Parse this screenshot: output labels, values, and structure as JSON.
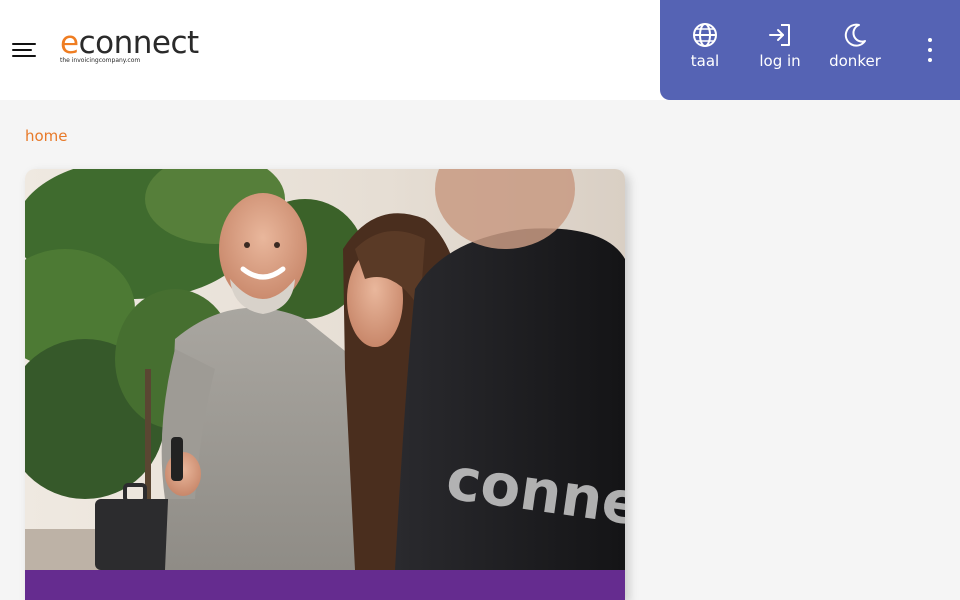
{
  "header": {
    "logo": {
      "e": "e",
      "rest": "connect",
      "tagline": "the invoicingcompany.com"
    },
    "toolbar": {
      "items": [
        {
          "label": "taal",
          "icon": "globe-icon"
        },
        {
          "label": "log in",
          "icon": "login-icon"
        },
        {
          "label": "donker",
          "icon": "moon-icon"
        }
      ]
    }
  },
  "breadcrumb": {
    "home": "home"
  },
  "colors": {
    "accent": "#ef7d22",
    "toolbar": "#5563b4",
    "band": "#652c8f"
  },
  "hero": {
    "image": "photo-people-office-econnect-shirt",
    "shirt_text": "connect"
  }
}
